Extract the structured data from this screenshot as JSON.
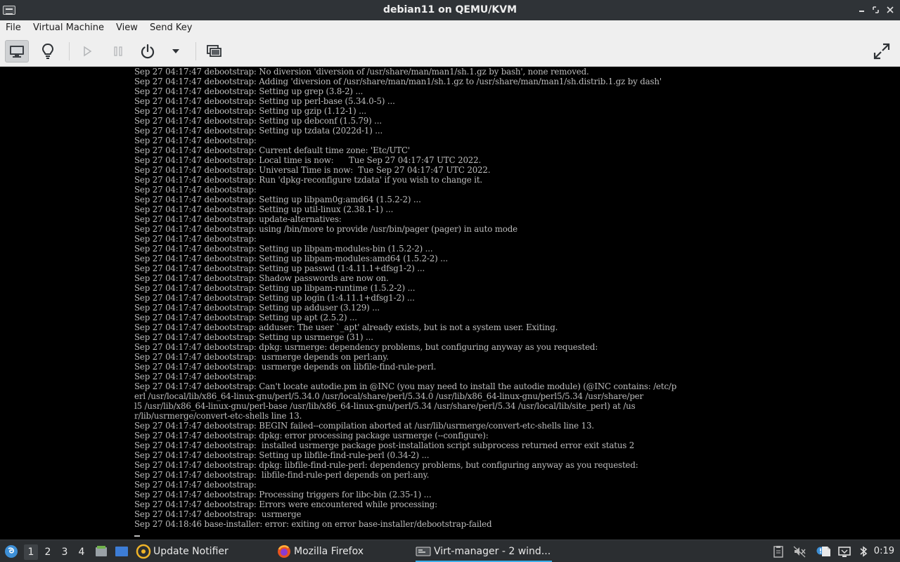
{
  "window": {
    "title": "debian11 on QEMU/KVM"
  },
  "menu": {
    "file": "File",
    "virtual_machine": "Virtual Machine",
    "view": "View",
    "send_key": "Send Key"
  },
  "toolbar": {
    "icons": [
      "console-icon",
      "details-lightbulb-icon",
      "run-icon",
      "pause-icon",
      "shutdown-icon",
      "shutdown-menu-arrow-icon",
      "snapshots-icon",
      "fullscreen-icon"
    ]
  },
  "console": {
    "lines": [
      "Sep 27 04:17:47 debootstrap: No diversion 'diversion of /usr/share/man/man1/sh.1.gz by bash', none removed.",
      "Sep 27 04:17:47 debootstrap: Adding 'diversion of /usr/share/man/man1/sh.1.gz to /usr/share/man/man1/sh.distrib.1.gz by dash'",
      "Sep 27 04:17:47 debootstrap: Setting up grep (3.8-2) ...",
      "Sep 27 04:17:47 debootstrap: Setting up perl-base (5.34.0-5) ...",
      "Sep 27 04:17:47 debootstrap: Setting up gzip (1.12-1) ...",
      "Sep 27 04:17:47 debootstrap: Setting up debconf (1.5.79) ...",
      "Sep 27 04:17:47 debootstrap: Setting up tzdata (2022d-1) ...",
      "Sep 27 04:17:47 debootstrap:",
      "Sep 27 04:17:47 debootstrap: Current default time zone: 'Etc/UTC'",
      "Sep 27 04:17:47 debootstrap: Local time is now:      Tue Sep 27 04:17:47 UTC 2022.",
      "Sep 27 04:17:47 debootstrap: Universal Time is now:  Tue Sep 27 04:17:47 UTC 2022.",
      "Sep 27 04:17:47 debootstrap: Run 'dpkg-reconfigure tzdata' if you wish to change it.",
      "Sep 27 04:17:47 debootstrap:",
      "Sep 27 04:17:47 debootstrap: Setting up libpam0g:amd64 (1.5.2-2) ...",
      "Sep 27 04:17:47 debootstrap: Setting up util-linux (2.38.1-1) ...",
      "Sep 27 04:17:47 debootstrap: update-alternatives:",
      "Sep 27 04:17:47 debootstrap: using /bin/more to provide /usr/bin/pager (pager) in auto mode",
      "Sep 27 04:17:47 debootstrap:",
      "Sep 27 04:17:47 debootstrap: Setting up libpam-modules-bin (1.5.2-2) ...",
      "Sep 27 04:17:47 debootstrap: Setting up libpam-modules:amd64 (1.5.2-2) ...",
      "Sep 27 04:17:47 debootstrap: Setting up passwd (1:4.11.1+dfsg1-2) ...",
      "Sep 27 04:17:47 debootstrap: Shadow passwords are now on.",
      "Sep 27 04:17:47 debootstrap: Setting up libpam-runtime (1.5.2-2) ...",
      "Sep 27 04:17:47 debootstrap: Setting up login (1:4.11.1+dfsg1-2) ...",
      "Sep 27 04:17:47 debootstrap: Setting up adduser (3.129) ...",
      "Sep 27 04:17:47 debootstrap: Setting up apt (2.5.2) ...",
      "Sep 27 04:17:47 debootstrap: adduser: The user `_apt' already exists, but is not a system user. Exiting.",
      "Sep 27 04:17:47 debootstrap: Setting up usrmerge (31) ...",
      "Sep 27 04:17:47 debootstrap: dpkg: usrmerge: dependency problems, but configuring anyway as you requested:",
      "Sep 27 04:17:47 debootstrap:  usrmerge depends on perl:any.",
      "Sep 27 04:17:47 debootstrap:  usrmerge depends on libfile-find-rule-perl.",
      "Sep 27 04:17:47 debootstrap:",
      "Sep 27 04:17:47 debootstrap: Can't locate autodie.pm in @INC (you may need to install the autodie module) (@INC contains: /etc/p",
      "erl /usr/local/lib/x86_64-linux-gnu/perl/5.34.0 /usr/local/share/perl/5.34.0 /usr/lib/x86_64-linux-gnu/perl5/5.34 /usr/share/per",
      "l5 /usr/lib/x86_64-linux-gnu/perl-base /usr/lib/x86_64-linux-gnu/perl/5.34 /usr/share/perl/5.34 /usr/local/lib/site_perl) at /us",
      "r/lib/usrmerge/convert-etc-shells line 13.",
      "Sep 27 04:17:47 debootstrap: BEGIN failed--compilation aborted at /usr/lib/usrmerge/convert-etc-shells line 13.",
      "Sep 27 04:17:47 debootstrap: dpkg: error processing package usrmerge (--configure):",
      "Sep 27 04:17:47 debootstrap:  installed usrmerge package post-installation script subprocess returned error exit status 2",
      "Sep 27 04:17:47 debootstrap: Setting up libfile-find-rule-perl (0.34-2) ...",
      "Sep 27 04:17:47 debootstrap: dpkg: libfile-find-rule-perl: dependency problems, but configuring anyway as you requested:",
      "Sep 27 04:17:47 debootstrap:  libfile-find-rule-perl depends on perl:any.",
      "Sep 27 04:17:47 debootstrap:",
      "Sep 27 04:17:47 debootstrap: Processing triggers for libc-bin (2.35-1) ...",
      "Sep 27 04:17:47 debootstrap: Errors were encountered while processing:",
      "Sep 27 04:17:47 debootstrap:  usrmerge",
      "Sep 27 04:18:46 base-installer: error: exiting on error base-installer/debootstrap-failed"
    ]
  },
  "taskbar": {
    "workspaces": [
      "1",
      "2",
      "3",
      "4"
    ],
    "current_workspace": "1",
    "tasks": [
      {
        "label": "Update Notifier",
        "icon": "update-notifier-icon"
      },
      {
        "label": "Mozilla Firefox",
        "icon": "firefox-icon"
      },
      {
        "label": "Virt-manager - 2 wind...",
        "icon": "virt-manager-icon"
      }
    ],
    "tray_icons": [
      "clipboard-icon",
      "mute-icon",
      "notification-icon",
      "files-icon",
      "network-icon",
      "bluetooth-icon"
    ],
    "clock": "0:19"
  },
  "colors": {
    "accent": "#3daee9",
    "console_bg": "#000000",
    "console_fg": "#bdbdbd"
  }
}
